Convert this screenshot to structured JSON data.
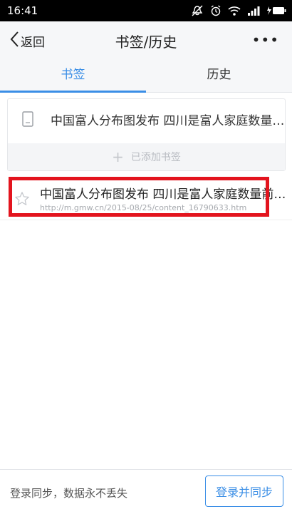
{
  "status_bar": {
    "time": "16:41",
    "icons": [
      "mute-icon",
      "alarm-icon",
      "wifi-icon",
      "signal-icon",
      "battery-charging-icon"
    ]
  },
  "header": {
    "back_label": "返回",
    "title": "书签/历史",
    "more_label": "•••"
  },
  "tabs": [
    {
      "label": "书签",
      "active": true
    },
    {
      "label": "历史",
      "active": false
    }
  ],
  "bookmarks": {
    "items": [
      {
        "title": "中国富人分布图发布 四川是富人家庭数量前十名的省份"
      }
    ],
    "added_plus": "+",
    "added_label": "已添加书签"
  },
  "history": {
    "items": [
      {
        "title": "中国富人分布图发布 四川是富人家庭数量前十名的省份",
        "url": "http://m.gmw.cn/2015-08/25/content_16790633.htm"
      }
    ]
  },
  "footer": {
    "hint": "登录同步，数据永不丢失",
    "button_label": "登录并同步"
  },
  "colors": {
    "accent": "#3a8ee6",
    "highlight": "#e3141e",
    "status_bar_bg": "#000000",
    "header_bg": "#f6f7f9"
  }
}
